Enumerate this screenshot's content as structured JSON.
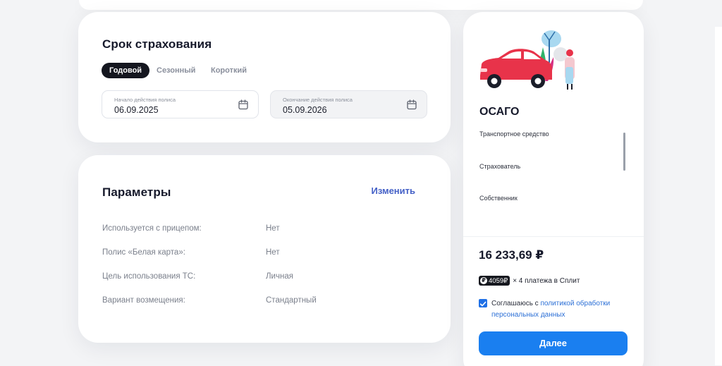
{
  "term": {
    "title": "Срок страхования",
    "tabs": [
      {
        "label": "Годовой",
        "active": true
      },
      {
        "label": "Сезонный",
        "active": false
      },
      {
        "label": "Короткий",
        "active": false
      }
    ],
    "start": {
      "label": "Начало действия полиса",
      "value": "06.09.2025"
    },
    "end": {
      "label": "Окончание действия полиса",
      "value": "05.09.2026"
    }
  },
  "params": {
    "title": "Параметры",
    "edit_label": "Изменить",
    "rows": [
      {
        "label": "Используется с прицепом:",
        "value": "Нет"
      },
      {
        "label": "Полис «Белая карта»:",
        "value": "Нет"
      },
      {
        "label": "Цель использования ТС:",
        "value": "Личная"
      },
      {
        "label": "Вариант возмещения:",
        "value": "Стандартный"
      }
    ]
  },
  "summary": {
    "title": "ОСАГО",
    "items": [
      "Транспортное средство",
      "Страхователь",
      "Собственник"
    ],
    "price": "16 233,69 ₽",
    "split_amount": "4059₽",
    "split_text": "× 4 платежа в Сплит",
    "consent_prefix": "Соглашаюсь с ",
    "consent_link": "политикой обработки персональных данных",
    "consent_checked": true,
    "next_label": "Далее"
  },
  "colors": {
    "accent": "#1a7ff0",
    "link": "#4561c7",
    "active_tab": "#14161f",
    "car": "#e8334a"
  }
}
